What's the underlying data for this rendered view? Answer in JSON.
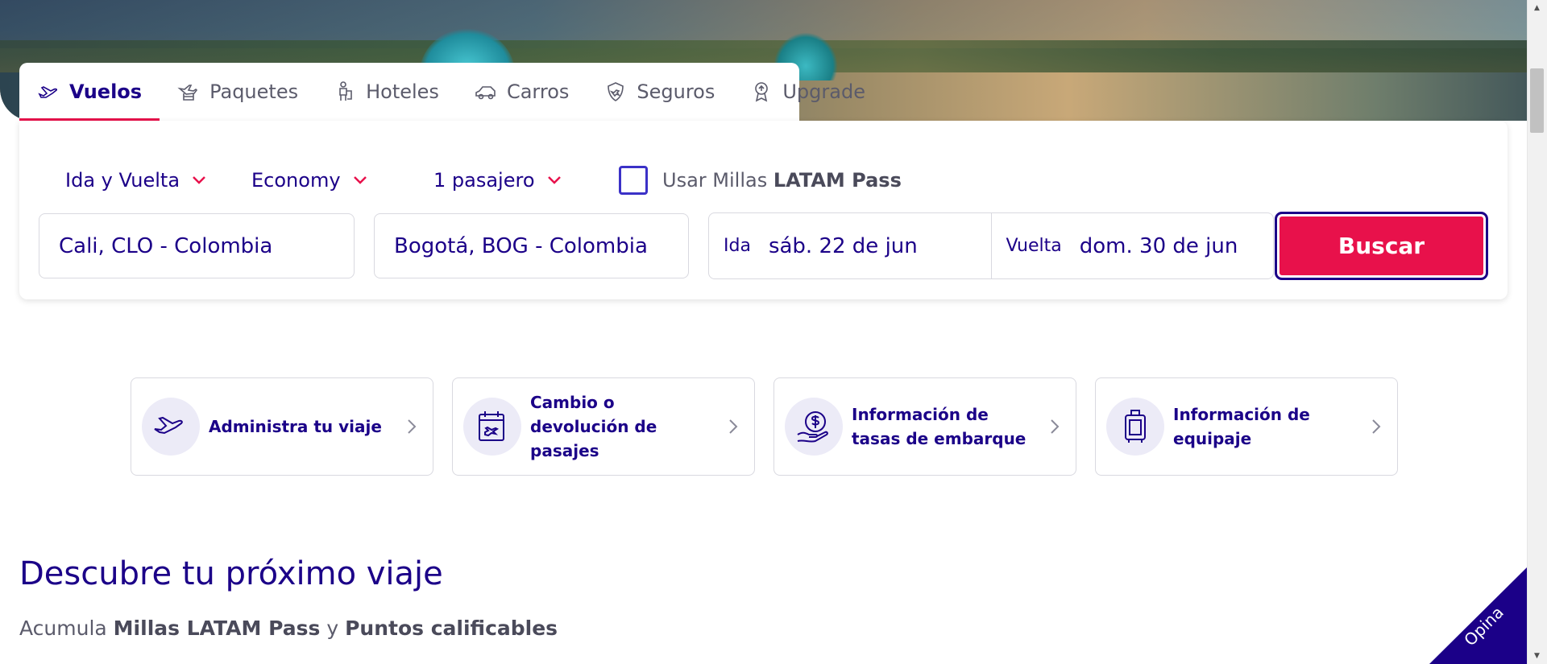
{
  "tabs": [
    {
      "label": "Vuelos",
      "icon": "plane-icon",
      "active": true
    },
    {
      "label": "Paquetes",
      "icon": "plane-hotel-icon",
      "active": false
    },
    {
      "label": "Hoteles",
      "icon": "bellboy-icon",
      "active": false
    },
    {
      "label": "Carros",
      "icon": "car-icon",
      "active": false
    },
    {
      "label": "Seguros",
      "icon": "shield-plane-icon",
      "active": false
    },
    {
      "label": "Upgrade",
      "icon": "upgrade-pin-icon",
      "active": false
    }
  ],
  "search": {
    "trip_type": "Ida y Vuelta",
    "cabin": "Economy",
    "passengers": "1 pasajero",
    "miles_prefix": "Usar Millas ",
    "miles_brand": "LATAM Pass",
    "miles_checked": false,
    "origin": "Cali, CLO - Colombia",
    "destination": "Bogotá, BOG - Colombia",
    "depart_label": "Ida",
    "depart_value": "sáb. 22 de jun",
    "return_label": "Vuelta",
    "return_value": "dom. 30 de jun",
    "button": "Buscar"
  },
  "quick_links": [
    {
      "label": "Administra tu viaje",
      "icon": "plane-icon"
    },
    {
      "label": "Cambio o devolución de pasajes",
      "icon": "calendar-plane-icon"
    },
    {
      "label": "Información de tasas de embarque",
      "icon": "coin-hand-icon"
    },
    {
      "label": "Información de equipaje",
      "icon": "suitcase-icon"
    }
  ],
  "discover": {
    "title": "Descubre tu próximo viaje",
    "sub_prefix": "Acumula ",
    "sub_brand": "Millas LATAM Pass",
    "sub_mid": " y ",
    "sub_points": "Puntos calificables"
  },
  "feedback": {
    "label": "Opina"
  },
  "colors": {
    "brand_navy": "#1b0088",
    "accent_pink": "#e8114b",
    "checkbox_blue": "#3b31c7",
    "icon_bg": "#ecebf7"
  }
}
